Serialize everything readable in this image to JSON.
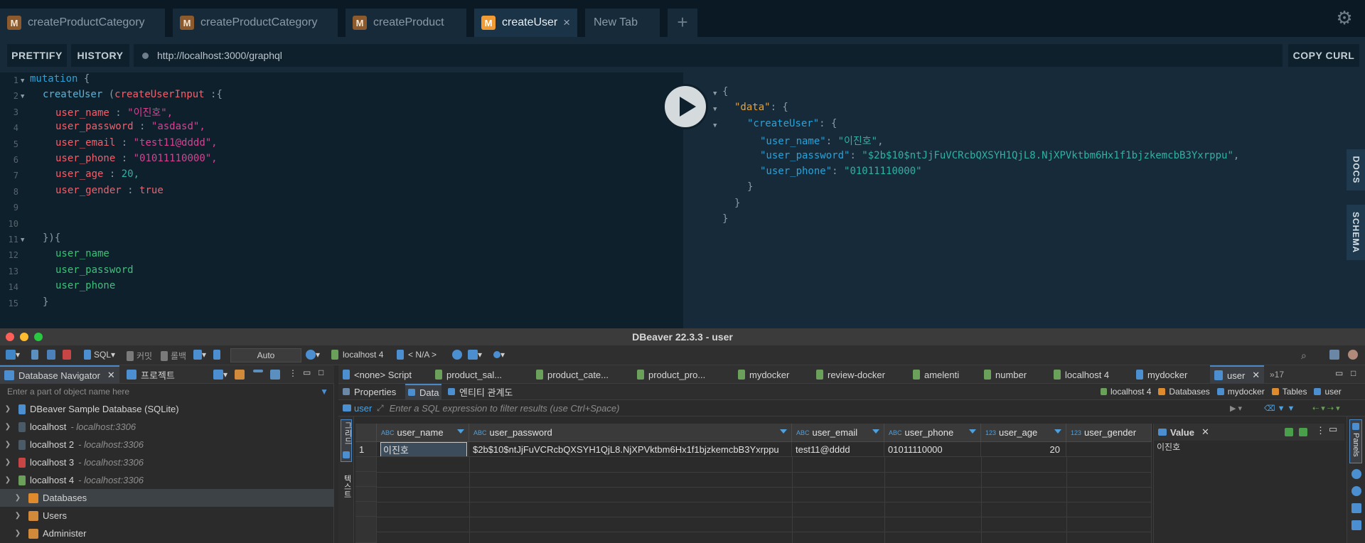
{
  "playground": {
    "tabs": [
      {
        "badge": "M",
        "label": "createProductCategory",
        "active": false
      },
      {
        "badge": "M",
        "label": "createProductCategory",
        "active": false
      },
      {
        "badge": "M",
        "label": "createProduct",
        "active": false
      },
      {
        "badge": "M",
        "label": "createUser",
        "active": true
      },
      {
        "label": "New Tab",
        "active": false
      }
    ],
    "tab_close": "×",
    "add_tab": "+",
    "toolbar": {
      "prettify": "PRETTIFY",
      "history": "HISTORY",
      "url": "http://localhost:3000/graphql",
      "copy_curl": "COPY CURL"
    },
    "line_numbers": [
      "1",
      "2",
      "3",
      "4",
      "5",
      "6",
      "7",
      "8",
      "9",
      "10",
      "11",
      "12",
      "13",
      "14",
      "15"
    ],
    "query": {
      "mutation": "mutation",
      "brace_open": "{",
      "fn_name": "createUser",
      "paren_open": "(",
      "input_arg": "createUserInput",
      "colon_brace": ":{",
      "fields": [
        {
          "key": "user_name",
          "value": "\"이진호\","
        },
        {
          "key": "user_password",
          "value": "\"asdasd\","
        },
        {
          "key": "user_email",
          "value": "\"test11@dddd\","
        },
        {
          "key": "user_phone",
          "value": "\"01011110000\","
        },
        {
          "key": "user_age",
          "value": "20,"
        },
        {
          "key": "user_gender",
          "value": "true"
        }
      ],
      "close_args": "}){",
      "selections": [
        "user_name",
        "user_password",
        "user_phone"
      ],
      "brace_close": "}"
    },
    "result": {
      "open": "{",
      "data_key": "\"data\"",
      "create_user_key": "\"createUser\"",
      "user_name": {
        "key": "\"user_name\"",
        "value": "\"이진호\""
      },
      "user_password": {
        "key": "\"user_password\"",
        "value": "\"$2b$10$ntJjFuVCRcbQXSYH1QjL8.NjXPVktbm6Hx1f1bjzkemcbB3Yxrppu\""
      },
      "user_phone": {
        "key": "\"user_phone\"",
        "value": "\"01011110000\""
      },
      "close": "}"
    },
    "side_tabs": {
      "docs": "DOCS",
      "schema": "SCHEMA"
    }
  },
  "dbeaver": {
    "title": "DBeaver 22.3.3 - user",
    "toolbar": {
      "sql": "SQL",
      "commit": "커밋",
      "rollback": "롤백",
      "mode": "Auto",
      "connection": "localhost 4",
      "schema": "< N/A >"
    },
    "navigator": {
      "tab_label": "Database Navigator",
      "projects_label": "프로젝트",
      "filter_placeholder": "Enter a part of object name here",
      "items": [
        {
          "label": "DBeaver Sample Database (SQLite)",
          "host": ""
        },
        {
          "label": "localhost",
          "host": "- localhost:3306"
        },
        {
          "label": "localhost 2",
          "host": "- localhost:3306"
        },
        {
          "label": "localhost 3",
          "host": "- localhost:3306"
        },
        {
          "label": "localhost 4",
          "host": "- localhost:3306"
        }
      ],
      "children": [
        {
          "label": "Databases"
        },
        {
          "label": "Users"
        },
        {
          "label": "Administer"
        }
      ]
    },
    "editor_tabs": [
      {
        "label": "<none> Script"
      },
      {
        "label": "product_sal..."
      },
      {
        "label": "product_cate..."
      },
      {
        "label": "product_pro..."
      },
      {
        "label": "mydocker"
      },
      {
        "label": "review-docker"
      },
      {
        "label": "amelenti"
      },
      {
        "label": "number"
      },
      {
        "label": "localhost 4"
      },
      {
        "label": "mydocker"
      },
      {
        "label": "user"
      }
    ],
    "more_tabs": "»17",
    "subtabs": {
      "properties": "Properties",
      "data": "Data",
      "er": "엔티티 관계도"
    },
    "breadcrumb": [
      "localhost 4",
      "Databases",
      "mydocker",
      "Tables",
      "user"
    ],
    "filter": {
      "table": "user",
      "placeholder": "Enter a SQL expression to filter results (use Ctrl+Space)"
    },
    "side_labels": {
      "grid": "그리드",
      "text": "텍스트"
    },
    "grid": {
      "columns": [
        {
          "type": "ABC",
          "name": "user_name"
        },
        {
          "type": "ABC",
          "name": "user_password"
        },
        {
          "type": "ABC",
          "name": "user_email"
        },
        {
          "type": "ABC",
          "name": "user_phone"
        },
        {
          "type": "123",
          "name": "user_age"
        },
        {
          "type": "123",
          "name": "user_gender"
        }
      ],
      "rows": [
        {
          "num": "1",
          "cells": [
            "이진호",
            "$2b$10$ntJjFuVCRcbQXSYH1QjL8.NjXPVktbm6Hx1f1bjzkemcbB3Yxrppu",
            "test11@dddd",
            "01011110000",
            "20",
            ""
          ]
        }
      ]
    },
    "value_panel": {
      "title": "Value",
      "content": "이진호"
    },
    "panels_label": "Panels"
  }
}
